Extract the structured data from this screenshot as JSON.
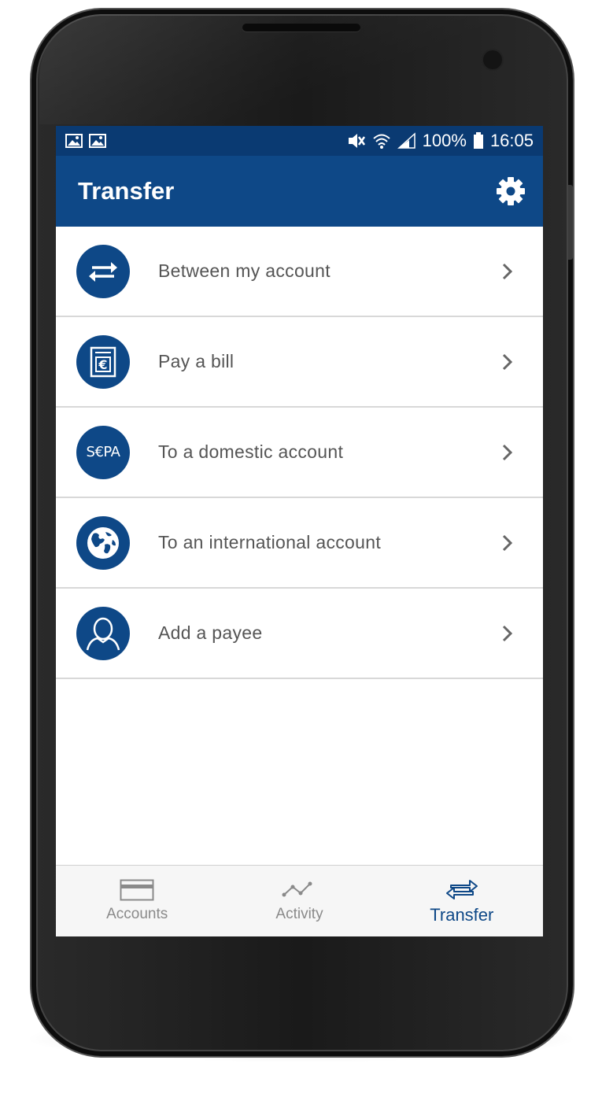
{
  "status_bar": {
    "battery": "100%",
    "time": "16:05"
  },
  "app_bar": {
    "title": "Transfer",
    "settings_icon": "gear-icon"
  },
  "menu": [
    {
      "label": "Between my account",
      "icon": "swap-arrows-icon"
    },
    {
      "label": "Pay a bill",
      "icon": "bill-euro-icon"
    },
    {
      "label": "To a domestic account",
      "icon": "sepa-icon",
      "icon_text": "S€PA"
    },
    {
      "label": "To an international account",
      "icon": "globe-icon"
    },
    {
      "label": "Add a payee",
      "icon": "user-icon"
    }
  ],
  "bottom_nav": {
    "items": [
      {
        "label": "Accounts",
        "icon": "card-icon",
        "active": false
      },
      {
        "label": "Activity",
        "icon": "activity-icon",
        "active": false
      },
      {
        "label": "Transfer",
        "icon": "transfer-icon",
        "active": true
      }
    ]
  },
  "colors": {
    "primary": "#0e4887",
    "status_bar": "#0a3a72",
    "label_text": "#555555",
    "inactive_nav": "#8a8a8a"
  }
}
